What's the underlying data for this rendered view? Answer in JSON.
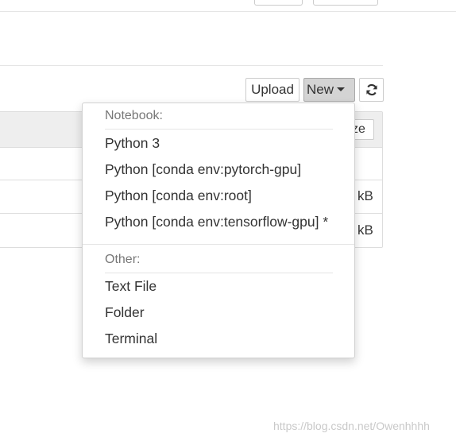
{
  "toolbar": {
    "upload_label": "Upload",
    "new_label": "New",
    "refresh_icon": "refresh-icon"
  },
  "list": {
    "sort_label": "ze",
    "rows": [
      {
        "size": ""
      },
      {
        "size": "kB"
      },
      {
        "size": "kB"
      }
    ]
  },
  "new_menu": {
    "notebook_header": "Notebook:",
    "notebook_items": [
      "Python 3",
      "Python [conda env:pytorch-gpu]",
      "Python [conda env:root]",
      "Python [conda env:tensorflow-gpu] *"
    ],
    "other_header": "Other:",
    "other_items": [
      "Text File",
      "Folder",
      "Terminal"
    ]
  },
  "watermark": "https://blog.csdn.net/Owenhhhh",
  "colors": {
    "new_button_bg": "#d4d4d4",
    "header_bg": "#eeeeee",
    "text": "#333333",
    "menu_header": "#777777"
  }
}
